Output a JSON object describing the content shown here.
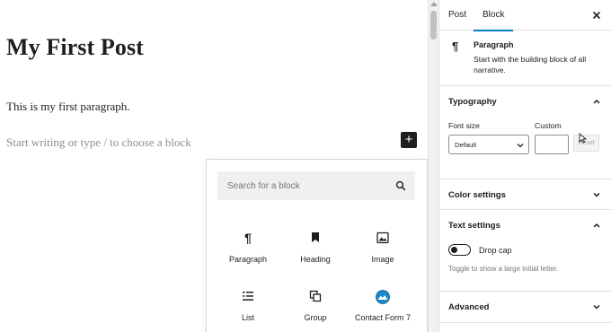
{
  "editor": {
    "post_title": "My First Post",
    "paragraph": "This is my first paragraph.",
    "placeholder": "Start writing or type / to choose a block",
    "add_block_glyph": "+"
  },
  "inserter": {
    "search_placeholder": "Search for a block",
    "blocks": [
      {
        "label": "Paragraph",
        "icon": "paragraph-icon"
      },
      {
        "label": "Heading",
        "icon": "bookmark-icon"
      },
      {
        "label": "Image",
        "icon": "image-icon"
      },
      {
        "label": "List",
        "icon": "list-icon"
      },
      {
        "label": "Group",
        "icon": "group-icon"
      },
      {
        "label": "Contact Form 7",
        "icon": "contact-form-7-icon"
      }
    ]
  },
  "sidebar": {
    "tabs": {
      "post": "Post",
      "block": "Block",
      "active": "Block"
    },
    "block_card": {
      "icon_glyph": "¶",
      "title": "Paragraph",
      "description": "Start with the building block of all narrative."
    },
    "typography": {
      "title": "Typography",
      "expanded": true,
      "font_size_label": "Font size",
      "custom_label": "Custom",
      "font_size_value": "Default",
      "custom_value": "",
      "reset_label": "Reset"
    },
    "color_settings": {
      "title": "Color settings",
      "expanded": false
    },
    "text_settings": {
      "title": "Text settings",
      "expanded": true,
      "drop_cap_label": "Drop cap",
      "drop_cap_on": false,
      "help": "Toggle to show a large initial letter."
    },
    "advanced": {
      "title": "Advanced",
      "expanded": false
    }
  },
  "colors": {
    "accent": "#007cba",
    "text": "#1e1e1e",
    "muted": "#757575",
    "contact_form_icon": "#1e88c8"
  }
}
